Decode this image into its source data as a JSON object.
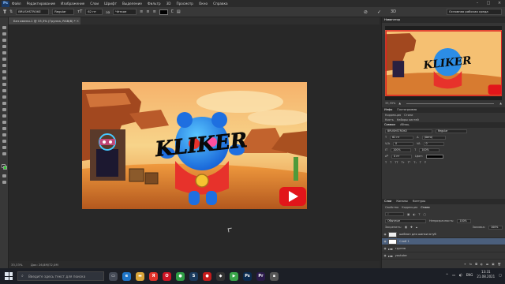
{
  "menubar": {
    "app_logo": "Ps",
    "items": [
      "Файл",
      "Редактирование",
      "Изображение",
      "Слои",
      "Шрифт",
      "Выделение",
      "Фильтр",
      "3D",
      "Просмотр",
      "Окно",
      "Справка"
    ],
    "win_controls": [
      "–",
      "□",
      "×"
    ]
  },
  "options_bar": {
    "font_family": "BRUSHSTROKE",
    "font_style": "Regular",
    "font_size": "62 пт",
    "antialias": "Чёткое",
    "workspace": "Основная рабочая среда"
  },
  "document": {
    "tab_title": "Без имени-1 @ 33,3% (Группа, RGB/8) *"
  },
  "artwork": {
    "overlay_text": "KLIKER",
    "youtube_icon": "youtube-play-icon"
  },
  "status": {
    "zoom": "33,33%",
    "doc_info": "Док: 26,8M/72,0M"
  },
  "navigator": {
    "title": "Навигатор",
    "zoom": "33,33%"
  },
  "properties": {
    "tabs": [
      "Инфо",
      "Гистограмма"
    ],
    "rows": [
      {
        "label": "Коррекция",
        "value": "Стили"
      },
      {
        "label": "Кисть",
        "value": "Наборы кистей"
      },
      {
        "label": "Символ",
        "value": "Абзац"
      }
    ],
    "font": "BRUSHSTROKE",
    "font_style": "Regular",
    "size": "62 пт",
    "leading": "(Авто)",
    "kerning": "0",
    "tracking": "0",
    "scale_v": "100%",
    "scale_h": "100%",
    "baseline": "0 пт",
    "color_label": "Цвет:"
  },
  "layers": {
    "tabs": [
      "Слои",
      "Каналы",
      "Контуры"
    ],
    "filter_tabs": [
      "Свойства",
      "Коррекция",
      "Стили"
    ],
    "blend_mode": "Обычные",
    "opacity_label": "Непрозрачность:",
    "opacity": "100%",
    "fill_label": "Заливка:",
    "fill": "100%",
    "lock_label": "Закрепить:",
    "items": [
      {
        "name": "шаблон для шапки ютуб",
        "selected": false
      },
      {
        "name": "Слой 1",
        "selected": true
      },
      {
        "name": "группа",
        "selected": false
      },
      {
        "name": "youtube",
        "selected": false
      }
    ]
  },
  "taskbar": {
    "search_placeholder": "Введите здесь текст для поиска",
    "apps": [
      {
        "name": "task-view",
        "color": "#444a56",
        "glyph": "▭"
      },
      {
        "name": "edge",
        "color": "#1e76c9",
        "glyph": "e"
      },
      {
        "name": "explorer",
        "color": "#d9a53a",
        "glyph": "▬"
      },
      {
        "name": "yandex",
        "color": "#e0332a",
        "glyph": "Я"
      },
      {
        "name": "opera",
        "color": "#cc1424",
        "glyph": "O"
      },
      {
        "name": "chrome",
        "color": "#2f9d45",
        "glyph": "●"
      },
      {
        "name": "steam",
        "color": "#1b3a5c",
        "glyph": "S"
      },
      {
        "name": "app-red",
        "color": "#c41b1b",
        "glyph": "●"
      },
      {
        "name": "app-dark",
        "color": "#333",
        "glyph": "◆"
      },
      {
        "name": "app-green",
        "color": "#3aa64a",
        "glyph": "▶"
      },
      {
        "name": "photoshop",
        "color": "#0b2b4f",
        "glyph": "Ps"
      },
      {
        "name": "app-pr",
        "color": "#2a1a4a",
        "glyph": "Pr"
      },
      {
        "name": "app-gray",
        "color": "#555",
        "glyph": "▪"
      }
    ],
    "lang": "ENG",
    "time": "13:31",
    "date": "21.08.2021"
  },
  "colors": {
    "foreground": "#111111",
    "background": "#33cc33",
    "selection": "#4b5f7c"
  }
}
